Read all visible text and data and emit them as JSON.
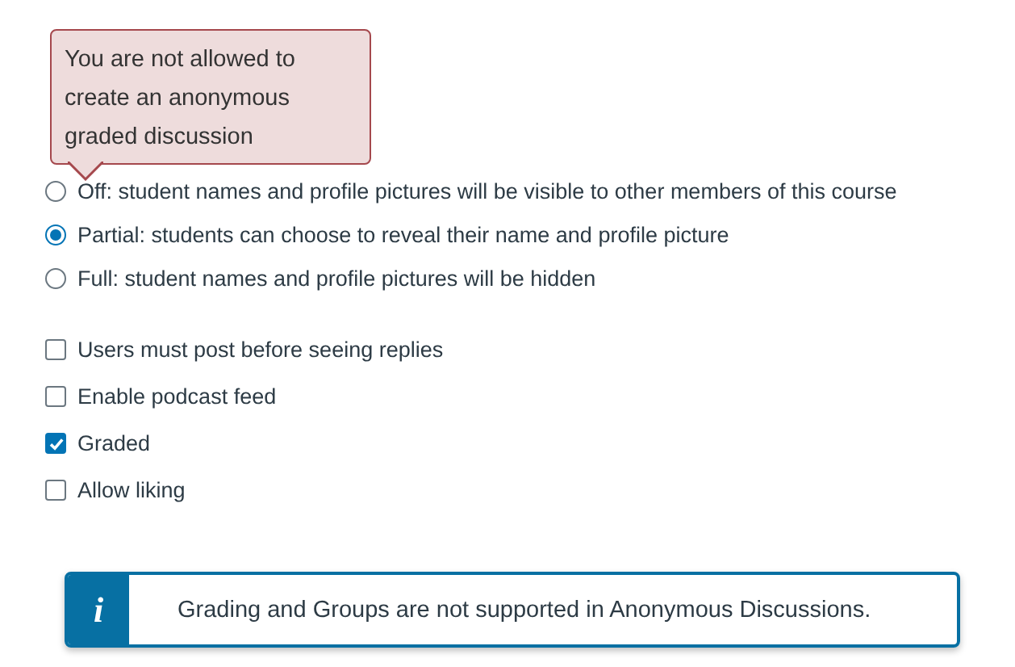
{
  "anonymity_options": [
    {
      "label": "Off: student names and profile pictures will be visible to other members of this course",
      "selected": false
    },
    {
      "label": "Partial: students can choose to reveal their name and profile picture",
      "selected": true
    },
    {
      "label": "Full: student names and profile pictures will be hidden",
      "selected": false
    }
  ],
  "settings": [
    {
      "label": "Users must post before seeing replies",
      "checked": false
    },
    {
      "label": "Enable podcast feed",
      "checked": false
    },
    {
      "label": "Graded",
      "checked": true
    },
    {
      "label": "Allow liking",
      "checked": false
    }
  ],
  "tooltip": {
    "text": "You are not allowed to create an anonymous graded discussion"
  },
  "info_alert": {
    "icon": "i",
    "text": "Grading and Groups are not supported in Anonymous Discussions."
  }
}
